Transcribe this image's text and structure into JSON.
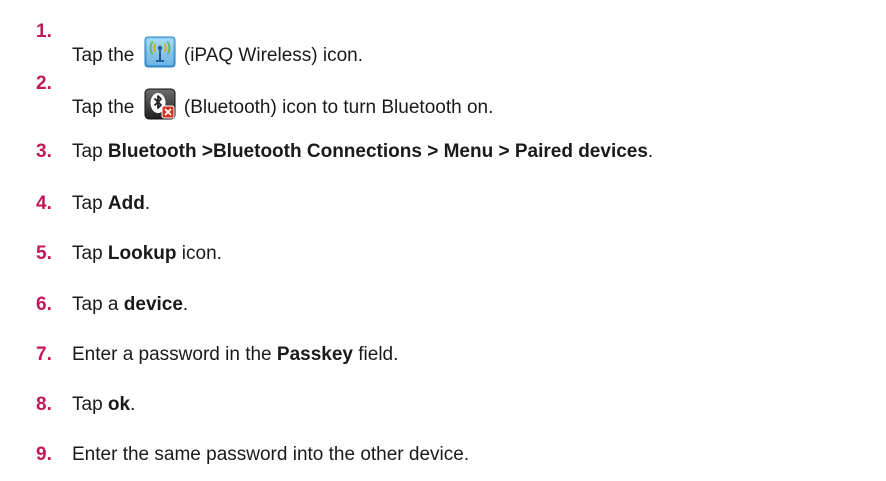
{
  "steps": [
    {
      "number": "1.",
      "pre": "Tap the ",
      "icon": "ipaq-wireless-icon",
      "post": " (iPAQ Wireless) icon."
    },
    {
      "number": "2.",
      "pre": "Tap the ",
      "icon": "bluetooth-icon",
      "post": " (Bluetooth) icon to turn Bluetooth on."
    },
    {
      "number": "3.",
      "pre": "Tap ",
      "bold": "Bluetooth >Bluetooth Connections > Menu > Paired devices",
      "post": "."
    },
    {
      "number": "4.",
      "pre": "Tap ",
      "bold": "Add",
      "post": "."
    },
    {
      "number": "5.",
      "pre": "Tap ",
      "bold": "Lookup",
      "post": " icon."
    },
    {
      "number": "6.",
      "pre": "Tap a ",
      "bold": "device",
      "post": "."
    },
    {
      "number": "7.",
      "pre": "Enter a password in the ",
      "bold": "Passkey",
      "post": " field."
    },
    {
      "number": "8.",
      "pre": "Tap ",
      "bold": "ok",
      "post": "."
    },
    {
      "number": "9.",
      "pre": "Enter the same password into the other device.",
      "post": ""
    }
  ],
  "colors": {
    "step_number": "#c2185b",
    "body_text": "#1a1a1a",
    "wireless_icon_bg": "#5ab0e8",
    "bluetooth_icon_bg": "#2b2b2b",
    "bluetooth_off_badge": "#d93025"
  }
}
